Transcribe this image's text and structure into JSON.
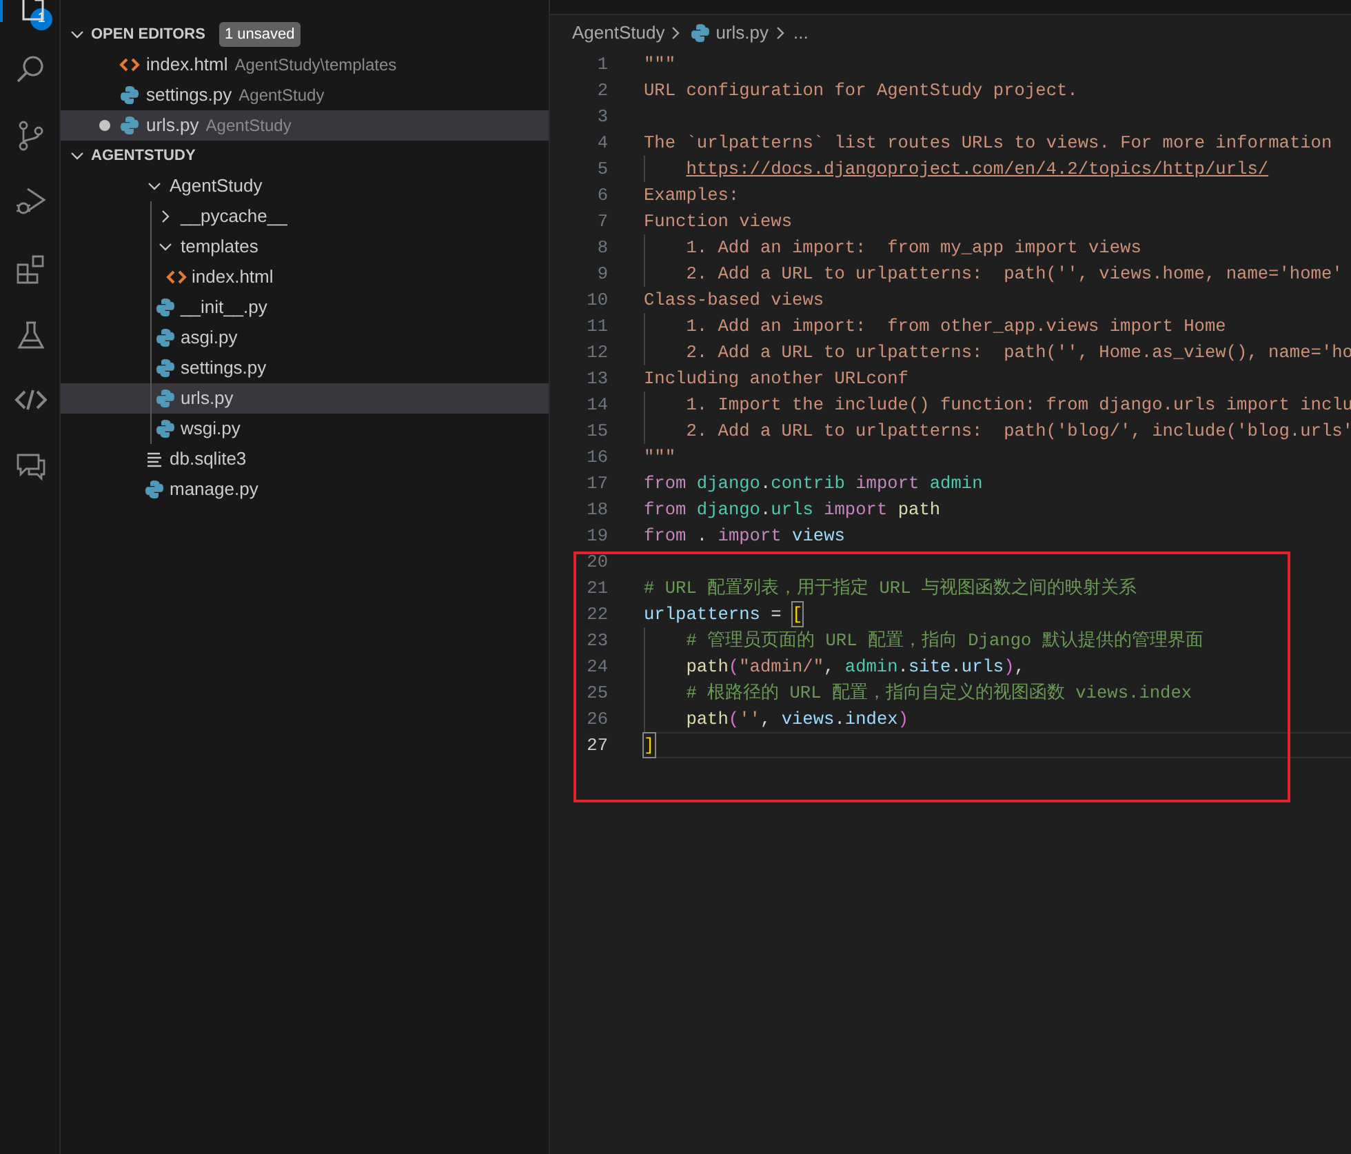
{
  "activity_bar": {
    "items": [
      {
        "kind": "explorer",
        "selected": true,
        "badge": "1"
      },
      {
        "kind": "search",
        "selected": false
      },
      {
        "kind": "source-control",
        "selected": false
      },
      {
        "kind": "run-debug",
        "selected": false
      },
      {
        "kind": "extensions",
        "selected": false
      },
      {
        "kind": "testing",
        "selected": false
      },
      {
        "kind": "remote",
        "selected": false
      },
      {
        "kind": "chat",
        "selected": false
      }
    ]
  },
  "sidebar": {
    "open_editors": {
      "title": "OPEN EDITORS",
      "expanded": true,
      "badge": "1 unsaved",
      "items": [
        {
          "kind": "html",
          "name": "index.html",
          "path": "AgentStudy\\templates",
          "dirty": false,
          "selected": false
        },
        {
          "kind": "python",
          "name": "settings.py",
          "path": "AgentStudy",
          "dirty": false,
          "selected": false
        },
        {
          "kind": "python",
          "name": "urls.py",
          "path": "AgentStudy",
          "dirty": true,
          "selected": true
        }
      ]
    },
    "project": {
      "title": "AGENTSTUDY",
      "expanded": true,
      "items": [
        {
          "kind": "folder",
          "name": "AgentStudy",
          "expanded": true,
          "selected": false,
          "children": [
            {
              "kind": "folder",
              "name": "__pycache__",
              "expanded": false,
              "selected": false
            },
            {
              "kind": "folder",
              "name": "templates",
              "expanded": true,
              "selected": false,
              "children": [
                {
                  "kind": "html",
                  "name": "index.html",
                  "selected": false
                }
              ]
            },
            {
              "kind": "python",
              "name": "__init__.py",
              "selected": false
            },
            {
              "kind": "python",
              "name": "asgi.py",
              "selected": false
            },
            {
              "kind": "python",
              "name": "settings.py",
              "selected": false
            },
            {
              "kind": "python",
              "name": "urls.py",
              "selected": true
            },
            {
              "kind": "python",
              "name": "wsgi.py",
              "selected": false
            }
          ]
        },
        {
          "kind": "text",
          "name": "db.sqlite3",
          "selected": false
        },
        {
          "kind": "python",
          "name": "manage.py",
          "selected": false
        }
      ]
    }
  },
  "editor": {
    "breadcrumb": [
      {
        "kind": "folder",
        "text": "AgentStudy"
      },
      {
        "kind": "python",
        "text": "urls.py"
      },
      {
        "kind": "more",
        "text": "..."
      }
    ],
    "annotation_box": true,
    "lines": [
      {
        "number": "1",
        "current": false,
        "indented": false,
        "tokens": [
          {
            "kind": "doc",
            "text": "\"\"\""
          }
        ]
      },
      {
        "number": "2",
        "current": false,
        "indented": false,
        "tokens": [
          {
            "kind": "doc",
            "text": "URL configuration for AgentStudy project."
          }
        ]
      },
      {
        "number": "3",
        "current": false,
        "indented": false
      },
      {
        "number": "4",
        "current": false,
        "indented": false,
        "tokens": [
          {
            "kind": "doc",
            "text": "The `urlpatterns` list routes URLs to views. For more information"
          }
        ]
      },
      {
        "number": "5",
        "current": false,
        "indented": true,
        "tokens": [
          {
            "kind": "link",
            "text": "https://docs.djangoproject.com/en/4.2/topics/http/urls/"
          }
        ]
      },
      {
        "number": "6",
        "current": false,
        "indented": false,
        "tokens": [
          {
            "kind": "doc",
            "text": "Examples:"
          }
        ]
      },
      {
        "number": "7",
        "current": false,
        "indented": false,
        "tokens": [
          {
            "kind": "doc",
            "text": "Function views"
          }
        ]
      },
      {
        "number": "8",
        "current": false,
        "indented": true,
        "tokens": [
          {
            "kind": "doc",
            "text": "1. Add an import:  from my_app import views"
          }
        ]
      },
      {
        "number": "9",
        "current": false,
        "indented": true,
        "tokens": [
          {
            "kind": "doc",
            "text": "2. Add a URL to urlpatterns:  path('', views.home, name='home'"
          }
        ]
      },
      {
        "number": "10",
        "current": false,
        "indented": false,
        "tokens": [
          {
            "kind": "doc",
            "text": "Class-based views"
          }
        ]
      },
      {
        "number": "11",
        "current": false,
        "indented": true,
        "tokens": [
          {
            "kind": "doc",
            "text": "1. Add an import:  from other_app.views import Home"
          }
        ]
      },
      {
        "number": "12",
        "current": false,
        "indented": true,
        "tokens": [
          {
            "kind": "doc",
            "text": "2. Add a URL to urlpatterns:  path('', Home.as_view(), name='ho"
          }
        ]
      },
      {
        "number": "13",
        "current": false,
        "indented": false,
        "tokens": [
          {
            "kind": "doc",
            "text": "Including another URLconf"
          }
        ]
      },
      {
        "number": "14",
        "current": false,
        "indented": true,
        "tokens": [
          {
            "kind": "doc",
            "text": "1. Import the include() function: from django.urls import inclu"
          }
        ]
      },
      {
        "number": "15",
        "current": false,
        "indented": true,
        "tokens": [
          {
            "kind": "doc",
            "text": "2. Add a URL to urlpatterns:  path('blog/', include('blog.urls'"
          }
        ]
      },
      {
        "number": "16",
        "current": false,
        "indented": false,
        "tokens": [
          {
            "kind": "doc",
            "text": "\"\"\""
          }
        ]
      },
      {
        "number": "17",
        "current": false,
        "indented": false,
        "tokens": [
          {
            "kind": "keyword",
            "text": "from "
          },
          {
            "kind": "module",
            "text": "django"
          },
          {
            "kind": "plain",
            "text": "."
          },
          {
            "kind": "module",
            "text": "contrib "
          },
          {
            "kind": "keyword",
            "text": "import "
          },
          {
            "kind": "module",
            "text": "admin"
          }
        ]
      },
      {
        "number": "18",
        "current": false,
        "indented": false,
        "tokens": [
          {
            "kind": "keyword",
            "text": "from "
          },
          {
            "kind": "module",
            "text": "django"
          },
          {
            "kind": "plain",
            "text": "."
          },
          {
            "kind": "module",
            "text": "urls "
          },
          {
            "kind": "keyword",
            "text": "import "
          },
          {
            "kind": "function",
            "text": "path"
          }
        ]
      },
      {
        "number": "19",
        "current": false,
        "indented": false,
        "tokens": [
          {
            "kind": "keyword",
            "text": "from"
          },
          {
            "kind": "plain",
            "text": " . "
          },
          {
            "kind": "keyword",
            "text": "import "
          },
          {
            "kind": "variable",
            "text": "views"
          }
        ]
      },
      {
        "number": "20",
        "current": false,
        "indented": false
      },
      {
        "number": "21",
        "current": false,
        "indented": false,
        "tokens": [
          {
            "kind": "comment",
            "text": "# URL 配置列表，用于指定 URL 与视图函数之间的映射关系"
          }
        ]
      },
      {
        "number": "22",
        "current": false,
        "indented": false,
        "tokens": [
          {
            "kind": "variable",
            "text": "urlpatterns"
          },
          {
            "kind": "plain",
            "text": " = "
          },
          {
            "kind": "bracket-match",
            "text": "["
          }
        ]
      },
      {
        "number": "23",
        "current": false,
        "indented": true,
        "tokens": [
          {
            "kind": "comment",
            "text": "# 管理员页面的 URL 配置，指向 Django 默认提供的管理界面"
          }
        ]
      },
      {
        "number": "24",
        "current": false,
        "indented": true,
        "tokens": [
          {
            "kind": "function",
            "text": "path"
          },
          {
            "kind": "paren",
            "text": "("
          },
          {
            "kind": "string",
            "text": "\"admin/\""
          },
          {
            "kind": "plain",
            "text": ", "
          },
          {
            "kind": "module",
            "text": "admin"
          },
          {
            "kind": "plain",
            "text": "."
          },
          {
            "kind": "variable",
            "text": "site"
          },
          {
            "kind": "plain",
            "text": "."
          },
          {
            "kind": "variable",
            "text": "urls"
          },
          {
            "kind": "paren",
            "text": ")"
          },
          {
            "kind": "plain",
            "text": ","
          }
        ]
      },
      {
        "number": "25",
        "current": false,
        "indented": true,
        "tokens": [
          {
            "kind": "comment",
            "text": "# 根路径的 URL 配置，指向自定义的视图函数 views.index"
          }
        ]
      },
      {
        "number": "26",
        "current": false,
        "indented": true,
        "tokens": [
          {
            "kind": "function",
            "text": "path"
          },
          {
            "kind": "paren",
            "text": "("
          },
          {
            "kind": "string",
            "text": "''"
          },
          {
            "kind": "plain",
            "text": ", "
          },
          {
            "kind": "variable",
            "text": "views"
          },
          {
            "kind": "plain",
            "text": "."
          },
          {
            "kind": "variable",
            "text": "index"
          },
          {
            "kind": "paren",
            "text": ")"
          }
        ]
      },
      {
        "number": "27",
        "current": true,
        "indented": false,
        "tokens": [
          {
            "kind": "bracket-match",
            "text": "]"
          }
        ]
      }
    ]
  }
}
